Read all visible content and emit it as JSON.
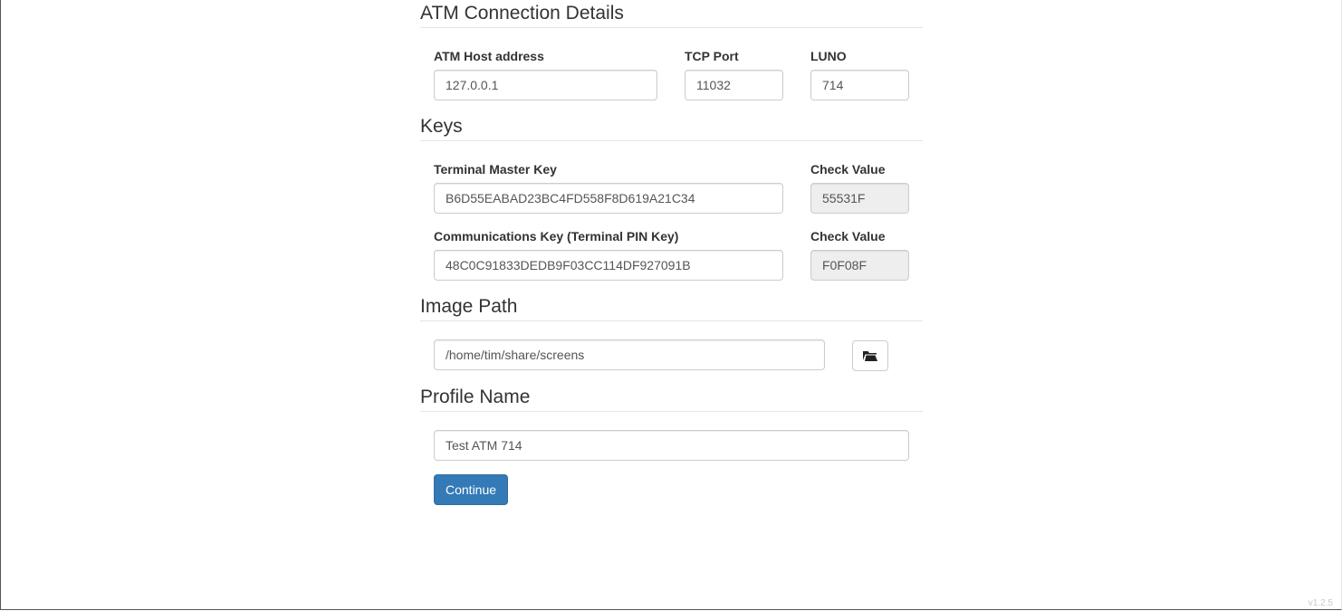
{
  "sections": {
    "connection": {
      "title": "ATM Connection Details",
      "host": {
        "label": "ATM Host address",
        "value": "127.0.0.1"
      },
      "port": {
        "label": "TCP Port",
        "value": "11032"
      },
      "luno": {
        "label": "LUNO",
        "value": "714"
      }
    },
    "keys": {
      "title": "Keys",
      "master_key": {
        "label": "Terminal Master Key",
        "value": "B6D55EABAD23BC4FD558F8D619A21C34"
      },
      "master_check": {
        "label": "Check Value",
        "value": "55531F"
      },
      "comms_key": {
        "label": "Communications Key (Terminal PIN Key)",
        "value": "48C0C91833DEDB9F03CC114DF927091B"
      },
      "comms_check": {
        "label": "Check Value",
        "value": "F0F08F"
      }
    },
    "image_path": {
      "title": "Image Path",
      "value": "/home/tim/share/screens",
      "browse_icon": "folder-open-icon"
    },
    "profile": {
      "title": "Profile Name",
      "value": "Test ATM 714"
    }
  },
  "actions": {
    "continue_label": "Continue"
  },
  "footer": {
    "version": "v1.2.5"
  },
  "colors": {
    "primary": "#337ab7",
    "readonly_bg": "#eeeeee",
    "border": "#cccccc"
  }
}
